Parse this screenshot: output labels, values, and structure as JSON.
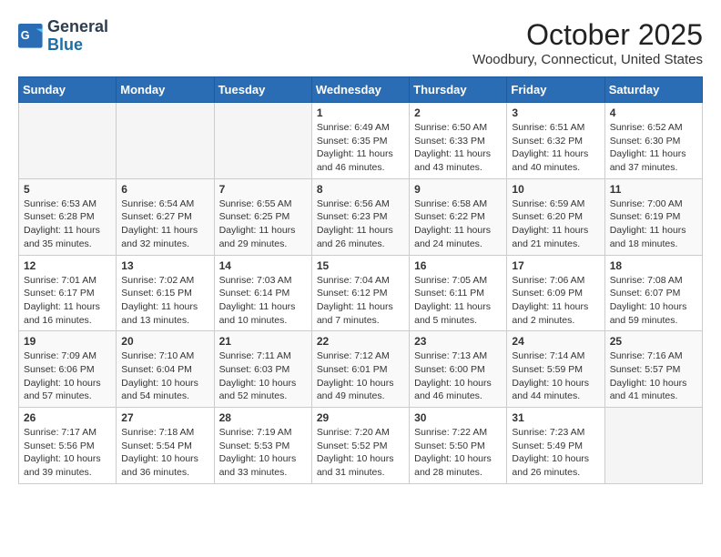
{
  "header": {
    "logo_line1": "General",
    "logo_line2": "Blue",
    "month": "October 2025",
    "location": "Woodbury, Connecticut, United States"
  },
  "days_of_week": [
    "Sunday",
    "Monday",
    "Tuesday",
    "Wednesday",
    "Thursday",
    "Friday",
    "Saturday"
  ],
  "weeks": [
    [
      {
        "day": "",
        "info": ""
      },
      {
        "day": "",
        "info": ""
      },
      {
        "day": "",
        "info": ""
      },
      {
        "day": "1",
        "info": "Sunrise: 6:49 AM\nSunset: 6:35 PM\nDaylight: 11 hours and 46 minutes."
      },
      {
        "day": "2",
        "info": "Sunrise: 6:50 AM\nSunset: 6:33 PM\nDaylight: 11 hours and 43 minutes."
      },
      {
        "day": "3",
        "info": "Sunrise: 6:51 AM\nSunset: 6:32 PM\nDaylight: 11 hours and 40 minutes."
      },
      {
        "day": "4",
        "info": "Sunrise: 6:52 AM\nSunset: 6:30 PM\nDaylight: 11 hours and 37 minutes."
      }
    ],
    [
      {
        "day": "5",
        "info": "Sunrise: 6:53 AM\nSunset: 6:28 PM\nDaylight: 11 hours and 35 minutes."
      },
      {
        "day": "6",
        "info": "Sunrise: 6:54 AM\nSunset: 6:27 PM\nDaylight: 11 hours and 32 minutes."
      },
      {
        "day": "7",
        "info": "Sunrise: 6:55 AM\nSunset: 6:25 PM\nDaylight: 11 hours and 29 minutes."
      },
      {
        "day": "8",
        "info": "Sunrise: 6:56 AM\nSunset: 6:23 PM\nDaylight: 11 hours and 26 minutes."
      },
      {
        "day": "9",
        "info": "Sunrise: 6:58 AM\nSunset: 6:22 PM\nDaylight: 11 hours and 24 minutes."
      },
      {
        "day": "10",
        "info": "Sunrise: 6:59 AM\nSunset: 6:20 PM\nDaylight: 11 hours and 21 minutes."
      },
      {
        "day": "11",
        "info": "Sunrise: 7:00 AM\nSunset: 6:19 PM\nDaylight: 11 hours and 18 minutes."
      }
    ],
    [
      {
        "day": "12",
        "info": "Sunrise: 7:01 AM\nSunset: 6:17 PM\nDaylight: 11 hours and 16 minutes."
      },
      {
        "day": "13",
        "info": "Sunrise: 7:02 AM\nSunset: 6:15 PM\nDaylight: 11 hours and 13 minutes."
      },
      {
        "day": "14",
        "info": "Sunrise: 7:03 AM\nSunset: 6:14 PM\nDaylight: 11 hours and 10 minutes."
      },
      {
        "day": "15",
        "info": "Sunrise: 7:04 AM\nSunset: 6:12 PM\nDaylight: 11 hours and 7 minutes."
      },
      {
        "day": "16",
        "info": "Sunrise: 7:05 AM\nSunset: 6:11 PM\nDaylight: 11 hours and 5 minutes."
      },
      {
        "day": "17",
        "info": "Sunrise: 7:06 AM\nSunset: 6:09 PM\nDaylight: 11 hours and 2 minutes."
      },
      {
        "day": "18",
        "info": "Sunrise: 7:08 AM\nSunset: 6:07 PM\nDaylight: 10 hours and 59 minutes."
      }
    ],
    [
      {
        "day": "19",
        "info": "Sunrise: 7:09 AM\nSunset: 6:06 PM\nDaylight: 10 hours and 57 minutes."
      },
      {
        "day": "20",
        "info": "Sunrise: 7:10 AM\nSunset: 6:04 PM\nDaylight: 10 hours and 54 minutes."
      },
      {
        "day": "21",
        "info": "Sunrise: 7:11 AM\nSunset: 6:03 PM\nDaylight: 10 hours and 52 minutes."
      },
      {
        "day": "22",
        "info": "Sunrise: 7:12 AM\nSunset: 6:01 PM\nDaylight: 10 hours and 49 minutes."
      },
      {
        "day": "23",
        "info": "Sunrise: 7:13 AM\nSunset: 6:00 PM\nDaylight: 10 hours and 46 minutes."
      },
      {
        "day": "24",
        "info": "Sunrise: 7:14 AM\nSunset: 5:59 PM\nDaylight: 10 hours and 44 minutes."
      },
      {
        "day": "25",
        "info": "Sunrise: 7:16 AM\nSunset: 5:57 PM\nDaylight: 10 hours and 41 minutes."
      }
    ],
    [
      {
        "day": "26",
        "info": "Sunrise: 7:17 AM\nSunset: 5:56 PM\nDaylight: 10 hours and 39 minutes."
      },
      {
        "day": "27",
        "info": "Sunrise: 7:18 AM\nSunset: 5:54 PM\nDaylight: 10 hours and 36 minutes."
      },
      {
        "day": "28",
        "info": "Sunrise: 7:19 AM\nSunset: 5:53 PM\nDaylight: 10 hours and 33 minutes."
      },
      {
        "day": "29",
        "info": "Sunrise: 7:20 AM\nSunset: 5:52 PM\nDaylight: 10 hours and 31 minutes."
      },
      {
        "day": "30",
        "info": "Sunrise: 7:22 AM\nSunset: 5:50 PM\nDaylight: 10 hours and 28 minutes."
      },
      {
        "day": "31",
        "info": "Sunrise: 7:23 AM\nSunset: 5:49 PM\nDaylight: 10 hours and 26 minutes."
      },
      {
        "day": "",
        "info": ""
      }
    ]
  ]
}
